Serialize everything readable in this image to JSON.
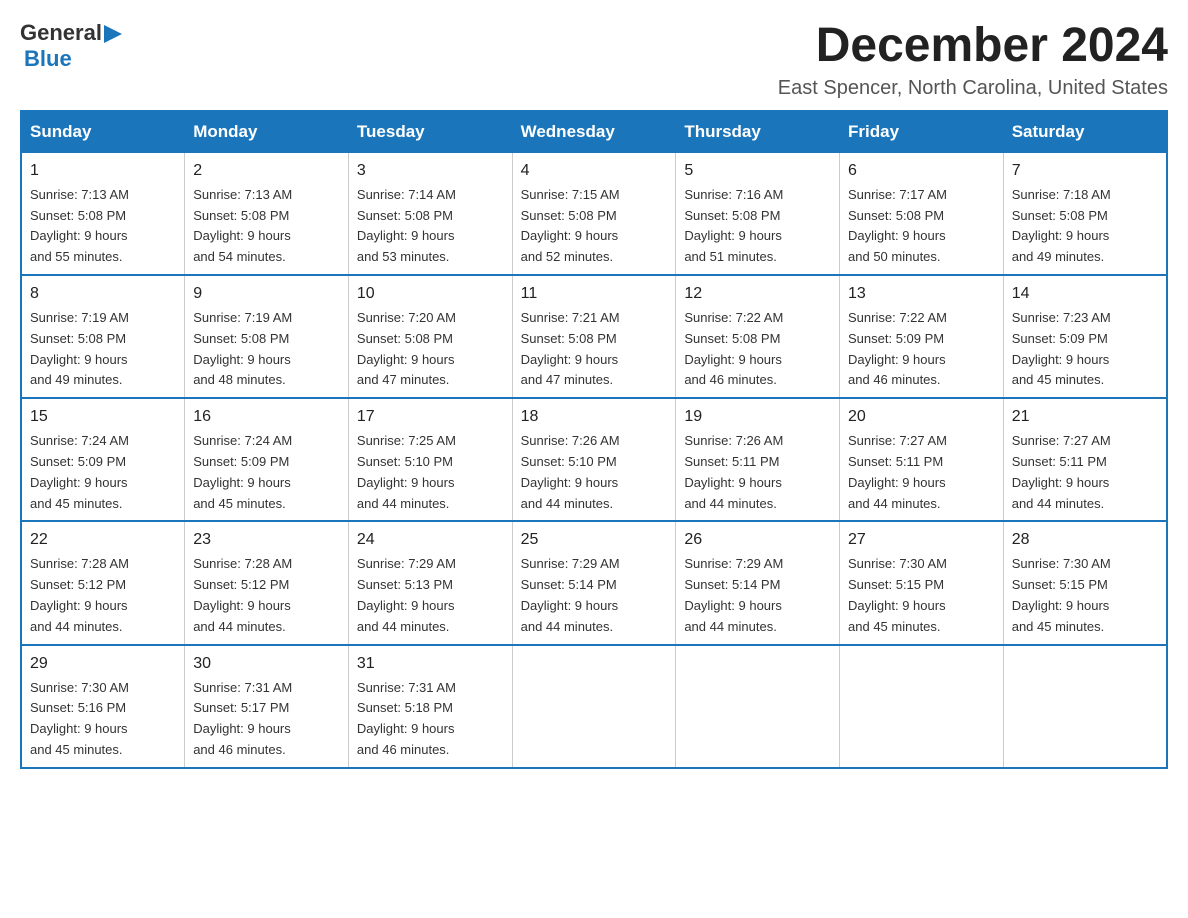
{
  "header": {
    "month_title": "December 2024",
    "location": "East Spencer, North Carolina, United States",
    "logo_general": "General",
    "logo_blue": "Blue"
  },
  "days_of_week": [
    "Sunday",
    "Monday",
    "Tuesday",
    "Wednesday",
    "Thursday",
    "Friday",
    "Saturday"
  ],
  "weeks": [
    [
      {
        "day": "1",
        "sunrise": "7:13 AM",
        "sunset": "5:08 PM",
        "daylight": "9 hours and 55 minutes."
      },
      {
        "day": "2",
        "sunrise": "7:13 AM",
        "sunset": "5:08 PM",
        "daylight": "9 hours and 54 minutes."
      },
      {
        "day": "3",
        "sunrise": "7:14 AM",
        "sunset": "5:08 PM",
        "daylight": "9 hours and 53 minutes."
      },
      {
        "day": "4",
        "sunrise": "7:15 AM",
        "sunset": "5:08 PM",
        "daylight": "9 hours and 52 minutes."
      },
      {
        "day": "5",
        "sunrise": "7:16 AM",
        "sunset": "5:08 PM",
        "daylight": "9 hours and 51 minutes."
      },
      {
        "day": "6",
        "sunrise": "7:17 AM",
        "sunset": "5:08 PM",
        "daylight": "9 hours and 50 minutes."
      },
      {
        "day": "7",
        "sunrise": "7:18 AM",
        "sunset": "5:08 PM",
        "daylight": "9 hours and 49 minutes."
      }
    ],
    [
      {
        "day": "8",
        "sunrise": "7:19 AM",
        "sunset": "5:08 PM",
        "daylight": "9 hours and 49 minutes."
      },
      {
        "day": "9",
        "sunrise": "7:19 AM",
        "sunset": "5:08 PM",
        "daylight": "9 hours and 48 minutes."
      },
      {
        "day": "10",
        "sunrise": "7:20 AM",
        "sunset": "5:08 PM",
        "daylight": "9 hours and 47 minutes."
      },
      {
        "day": "11",
        "sunrise": "7:21 AM",
        "sunset": "5:08 PM",
        "daylight": "9 hours and 47 minutes."
      },
      {
        "day": "12",
        "sunrise": "7:22 AM",
        "sunset": "5:08 PM",
        "daylight": "9 hours and 46 minutes."
      },
      {
        "day": "13",
        "sunrise": "7:22 AM",
        "sunset": "5:09 PM",
        "daylight": "9 hours and 46 minutes."
      },
      {
        "day": "14",
        "sunrise": "7:23 AM",
        "sunset": "5:09 PM",
        "daylight": "9 hours and 45 minutes."
      }
    ],
    [
      {
        "day": "15",
        "sunrise": "7:24 AM",
        "sunset": "5:09 PM",
        "daylight": "9 hours and 45 minutes."
      },
      {
        "day": "16",
        "sunrise": "7:24 AM",
        "sunset": "5:09 PM",
        "daylight": "9 hours and 45 minutes."
      },
      {
        "day": "17",
        "sunrise": "7:25 AM",
        "sunset": "5:10 PM",
        "daylight": "9 hours and 44 minutes."
      },
      {
        "day": "18",
        "sunrise": "7:26 AM",
        "sunset": "5:10 PM",
        "daylight": "9 hours and 44 minutes."
      },
      {
        "day": "19",
        "sunrise": "7:26 AM",
        "sunset": "5:11 PM",
        "daylight": "9 hours and 44 minutes."
      },
      {
        "day": "20",
        "sunrise": "7:27 AM",
        "sunset": "5:11 PM",
        "daylight": "9 hours and 44 minutes."
      },
      {
        "day": "21",
        "sunrise": "7:27 AM",
        "sunset": "5:11 PM",
        "daylight": "9 hours and 44 minutes."
      }
    ],
    [
      {
        "day": "22",
        "sunrise": "7:28 AM",
        "sunset": "5:12 PM",
        "daylight": "9 hours and 44 minutes."
      },
      {
        "day": "23",
        "sunrise": "7:28 AM",
        "sunset": "5:12 PM",
        "daylight": "9 hours and 44 minutes."
      },
      {
        "day": "24",
        "sunrise": "7:29 AM",
        "sunset": "5:13 PM",
        "daylight": "9 hours and 44 minutes."
      },
      {
        "day": "25",
        "sunrise": "7:29 AM",
        "sunset": "5:14 PM",
        "daylight": "9 hours and 44 minutes."
      },
      {
        "day": "26",
        "sunrise": "7:29 AM",
        "sunset": "5:14 PM",
        "daylight": "9 hours and 44 minutes."
      },
      {
        "day": "27",
        "sunrise": "7:30 AM",
        "sunset": "5:15 PM",
        "daylight": "9 hours and 45 minutes."
      },
      {
        "day": "28",
        "sunrise": "7:30 AM",
        "sunset": "5:15 PM",
        "daylight": "9 hours and 45 minutes."
      }
    ],
    [
      {
        "day": "29",
        "sunrise": "7:30 AM",
        "sunset": "5:16 PM",
        "daylight": "9 hours and 45 minutes."
      },
      {
        "day": "30",
        "sunrise": "7:31 AM",
        "sunset": "5:17 PM",
        "daylight": "9 hours and 46 minutes."
      },
      {
        "day": "31",
        "sunrise": "7:31 AM",
        "sunset": "5:18 PM",
        "daylight": "9 hours and 46 minutes."
      },
      null,
      null,
      null,
      null
    ]
  ]
}
